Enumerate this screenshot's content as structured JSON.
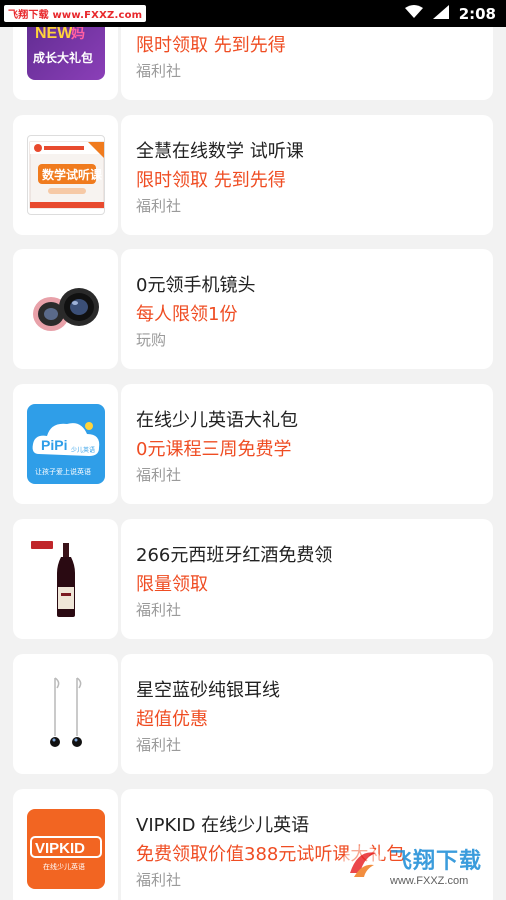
{
  "status_bar": {
    "watermark": "飞翔下载 www.FXXZ.com",
    "time": "2:08"
  },
  "items": [
    {
      "title": "",
      "promo": "限时领取 先到先得",
      "source": "福利社",
      "icon": "gift-pack-icon",
      "thumb_text": "NEW妈成长大礼包"
    },
    {
      "title": "全慧在线数学 试听课",
      "promo": "限时领取 先到先得",
      "source": "福利社",
      "icon": "math-trial-icon",
      "thumb_text": "数学试听课"
    },
    {
      "title": "0元领手机镜头",
      "promo": "每人限领1份",
      "source": "玩购",
      "icon": "camera-lens-icon",
      "thumb_text": ""
    },
    {
      "title": "在线少儿英语大礼包",
      "promo": "0元课程三周免费学",
      "source": "福利社",
      "icon": "pipi-english-icon",
      "thumb_text": "PiPi"
    },
    {
      "title": "266元西班牙红酒免费领",
      "promo": "限量领取",
      "source": "福利社",
      "icon": "wine-bottle-icon",
      "thumb_text": ""
    },
    {
      "title": "星空蓝砂纯银耳线",
      "promo": "超值优惠",
      "source": "福利社",
      "icon": "earrings-icon",
      "thumb_text": ""
    },
    {
      "title": "VIPKID 在线少儿英语",
      "promo": "免费领取价值388元试听课大礼包",
      "source": "福利社",
      "icon": "vipkid-logo-icon",
      "thumb_text": "VIPKID"
    }
  ],
  "overlay": {
    "watermark_text": "飞翔下载",
    "watermark_url": "www.FXXZ.com"
  },
  "colors": {
    "promo": "#ef4d23",
    "title": "#222222",
    "source": "#9b9b9b",
    "background": "#f2f2f2"
  }
}
